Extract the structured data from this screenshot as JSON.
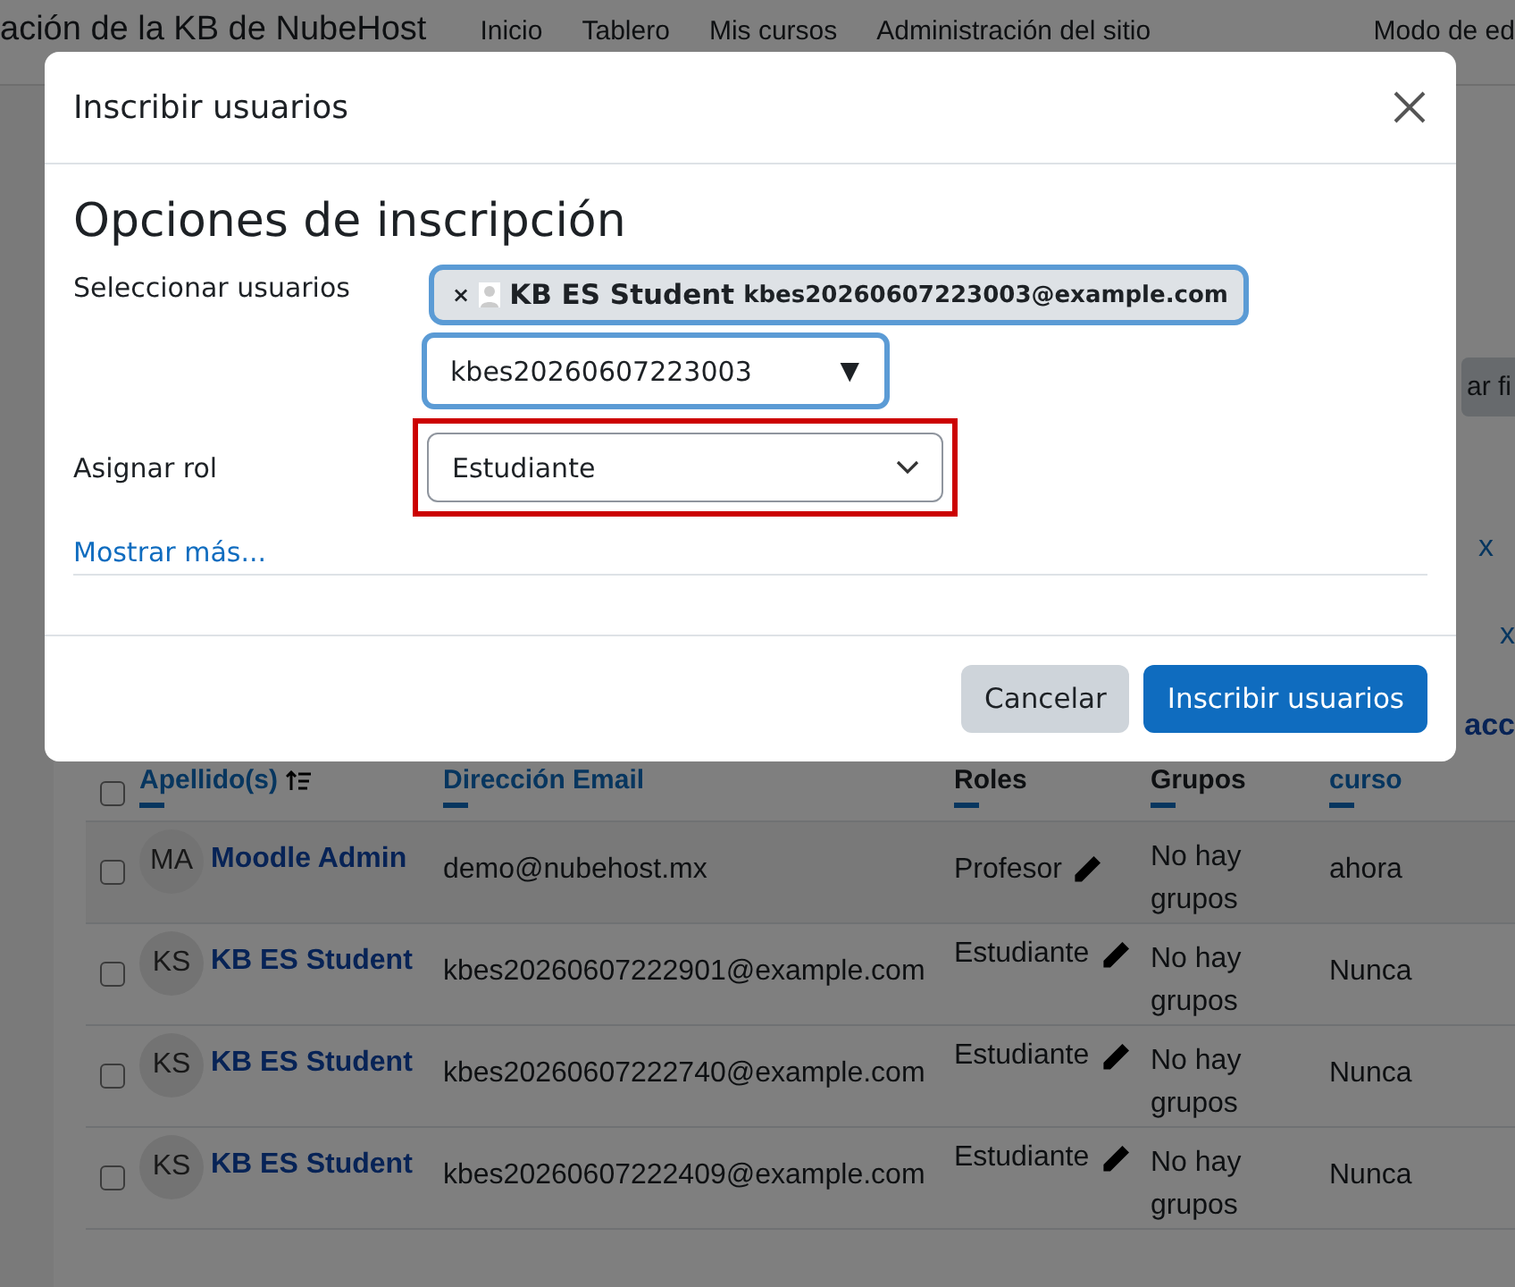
{
  "page": {
    "site_title": "ación de la KB de NubeHost",
    "nav": [
      "Inicio",
      "Tablero",
      "Mis cursos",
      "Administración del sitio"
    ],
    "edit_mode": "Modo de ed"
  },
  "filter_button": {
    "label": "ar fi"
  },
  "filter_chips": [
    "x",
    "x"
  ],
  "table": {
    "header_fragment": "acc",
    "select_all_checked": false,
    "columns": [
      {
        "label": "Apellido(s)",
        "kind": "sorted"
      },
      {
        "label": "Dirección Email",
        "kind": "link"
      },
      {
        "label": "Roles",
        "kind": "plain"
      },
      {
        "label": "Grupos",
        "kind": "plain"
      },
      {
        "label": "curso",
        "kind": "link"
      }
    ],
    "rows": [
      {
        "checked": false,
        "highlighted": true,
        "initials": "MA",
        "name": "Moodle Admin",
        "email": "demo@nubehost.mx",
        "role": "Profesor",
        "groups": "No hay grupos",
        "last_access": "ahora"
      },
      {
        "checked": false,
        "highlighted": false,
        "initials": "KS",
        "name": "KB ES Student",
        "email": "kbes20260607222901@example.com",
        "role": "Estudiante",
        "groups": "No hay grupos",
        "last_access": "Nunca"
      },
      {
        "checked": false,
        "highlighted": false,
        "initials": "KS",
        "name": "KB ES Student",
        "email": "kbes20260607222740@example.com",
        "role": "Estudiante",
        "groups": "No hay grupos",
        "last_access": "Nunca"
      },
      {
        "checked": false,
        "highlighted": false,
        "initials": "KS",
        "name": "KB ES Student",
        "email": "kbes20260607222409@example.com",
        "role": "Estudiante",
        "groups": "No hay grupos",
        "last_access": "Nunca"
      }
    ]
  },
  "modal": {
    "title": "Inscribir usuarios",
    "heading": "Opciones de inscripción",
    "select_users": {
      "label": "Seleccionar usuarios",
      "chip_remove": "×",
      "chip_name": "KB ES Student",
      "chip_email": "kbes20260607223003@example.com",
      "search_value": "kbes20260607223003",
      "search_arrow": "▼"
    },
    "role": {
      "label": "Asignar rol",
      "value": "Estudiante",
      "highlighted": true
    },
    "show_more": "Mostrar más...",
    "buttons": [
      {
        "label": "Cancelar",
        "kind": "secondary"
      },
      {
        "label": "Inscribir usuarios",
        "kind": "primary"
      }
    ]
  }
}
